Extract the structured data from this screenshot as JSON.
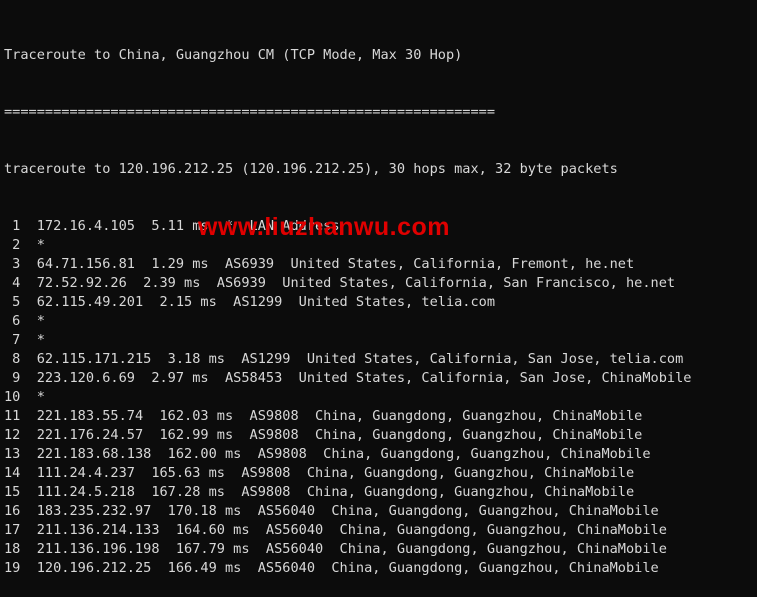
{
  "terminal": {
    "title": "Traceroute to China, Guangzhou CM (TCP Mode, Max 30 Hop)",
    "separator": "============================================================",
    "command": "traceroute to 120.196.212.25 (120.196.212.25), 30 hops max, 32 byte packets",
    "hops": [
      " 1  172.16.4.105  5.11 ms  *  LAN Address",
      " 2  *",
      " 3  64.71.156.81  1.29 ms  AS6939  United States, California, Fremont, he.net",
      " 4  72.52.92.26  2.39 ms  AS6939  United States, California, San Francisco, he.net",
      " 5  62.115.49.201  2.15 ms  AS1299  United States, telia.com",
      " 6  *",
      " 7  *",
      " 8  62.115.171.215  3.18 ms  AS1299  United States, California, San Jose, telia.com",
      " 9  223.120.6.69  2.97 ms  AS58453  United States, California, San Jose, ChinaMobile",
      "10  *",
      "11  221.183.55.74  162.03 ms  AS9808  China, Guangdong, Guangzhou, ChinaMobile",
      "12  221.176.24.57  162.99 ms  AS9808  China, Guangdong, Guangzhou, ChinaMobile",
      "13  221.183.68.138  162.00 ms  AS9808  China, Guangdong, Guangzhou, ChinaMobile",
      "14  111.24.4.237  165.63 ms  AS9808  China, Guangdong, Guangzhou, ChinaMobile",
      "15  111.24.5.218  167.28 ms  AS9808  China, Guangdong, Guangzhou, ChinaMobile",
      "16  183.235.232.97  170.18 ms  AS56040  China, Guangdong, Guangzhou, ChinaMobile",
      "17  211.136.214.133  164.60 ms  AS56040  China, Guangdong, Guangzhou, ChinaMobile",
      "18  211.136.196.198  167.79 ms  AS56040  China, Guangdong, Guangzhou, ChinaMobile",
      "19  120.196.212.25  166.49 ms  AS56040  China, Guangdong, Guangzhou, ChinaMobile"
    ]
  },
  "watermark": "www.liuzhanwu.com",
  "colors": {
    "background": "#0c0c0c",
    "text": "#d8d8d8",
    "watermark": "#e00000"
  }
}
